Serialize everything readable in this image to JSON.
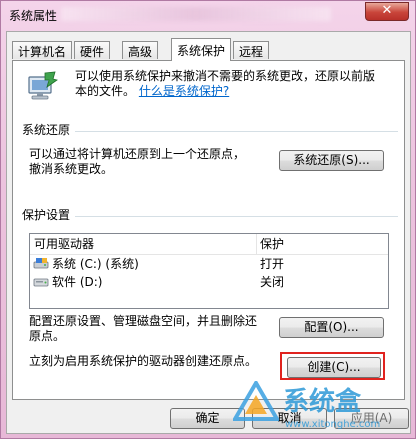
{
  "window": {
    "title": "系统属性",
    "close_label": "✕"
  },
  "tabs": [
    {
      "label": "计算机名"
    },
    {
      "label": "硬件"
    },
    {
      "label": "高级"
    },
    {
      "label": "系统保护"
    },
    {
      "label": "远程"
    }
  ],
  "intro": {
    "line1": "可以使用系统保护来撤消不需要的系统更改，还原以前版",
    "line2_prefix": "本的文件。",
    "link": "什么是系统保护?"
  },
  "restore_section": {
    "heading": "系统还原",
    "line1": "可以通过将计算机还原到上一个还原点，",
    "line2": "撤消系统更改。",
    "button": "系统还原(S)..."
  },
  "protection_section": {
    "heading": "保护设置",
    "columns": [
      "可用驱动器",
      "保护"
    ],
    "rows": [
      {
        "drive": "系统 (C:) (系统)",
        "status": "打开"
      },
      {
        "drive": "软件 (D:)",
        "status": "关闭"
      }
    ],
    "config_line1": "配置还原设置、管理磁盘空间，并且删除还",
    "config_line2": "原点。",
    "config_button": "配置(O)...",
    "create_text": "立刻为启用系统保护的驱动器创建还原点。",
    "create_button": "创建(C)..."
  },
  "footer": {
    "ok": "确定",
    "cancel": "取消",
    "apply": "应用(A)"
  },
  "watermark": {
    "text": "系统盒",
    "url": "www.xitonghe.com"
  },
  "colors": {
    "highlight_border": "#e0231f",
    "link": "#0066cc",
    "titlebar": "#ecc3de"
  }
}
